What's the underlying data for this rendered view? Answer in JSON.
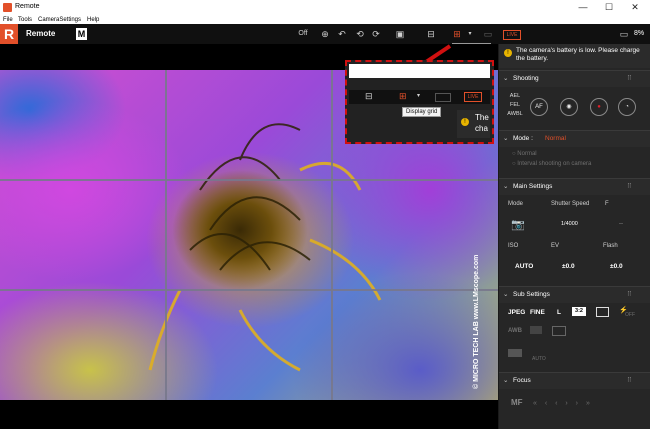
{
  "window": {
    "title": "Remote",
    "minimize": "—",
    "maximize": "☐",
    "close": "✕"
  },
  "menu": {
    "items": [
      "File",
      "Tools",
      "CameraSettings",
      "Help"
    ]
  },
  "toolbar": {
    "app_name": "Remote",
    "mode_badge": "M",
    "off_label": "Off",
    "live_badge": "LIVE",
    "battery": "8%"
  },
  "tooltip": {
    "display_grid": "Display grid"
  },
  "callout": {
    "live_badge": "LIVE",
    "partial_text_1": "The",
    "partial_text_2": "cha"
  },
  "watermark": "© MICRO TECH LAB www.LMscope.com",
  "panel": {
    "battery_warning": "The camera's battery is low. Please charge the battery.",
    "shooting": {
      "title": "Shooting",
      "ael": "AEL",
      "fel": "FEL",
      "awbl": "AWBL",
      "af": "AF"
    },
    "mode": {
      "title": "Mode :",
      "value": "Normal",
      "options": [
        "Normal",
        "Interval shooting on camera"
      ]
    },
    "main_settings": {
      "title": "Main Settings",
      "mode_label": "Mode",
      "shutter_label": "Shutter Speed",
      "f_label": "F",
      "shutter_value": "1/4000",
      "f_value": "--",
      "iso_label": "ISO",
      "ev_label": "EV",
      "flash_label": "Flash",
      "iso_value": "AUTO",
      "ev_value": "±0.0",
      "flash_value": "±0.0"
    },
    "sub_settings": {
      "title": "Sub Settings",
      "format": "JPEG",
      "quality": "FINE",
      "size": "L",
      "ratio": "3:2",
      "awb": "AWB",
      "off": "OFF",
      "auto": "AUTO"
    },
    "focus": {
      "title": "Focus",
      "mf": "MF"
    }
  },
  "colors": {
    "accent": "#e2502a",
    "warning": "#e8b400",
    "panel_bg": "#262626"
  }
}
